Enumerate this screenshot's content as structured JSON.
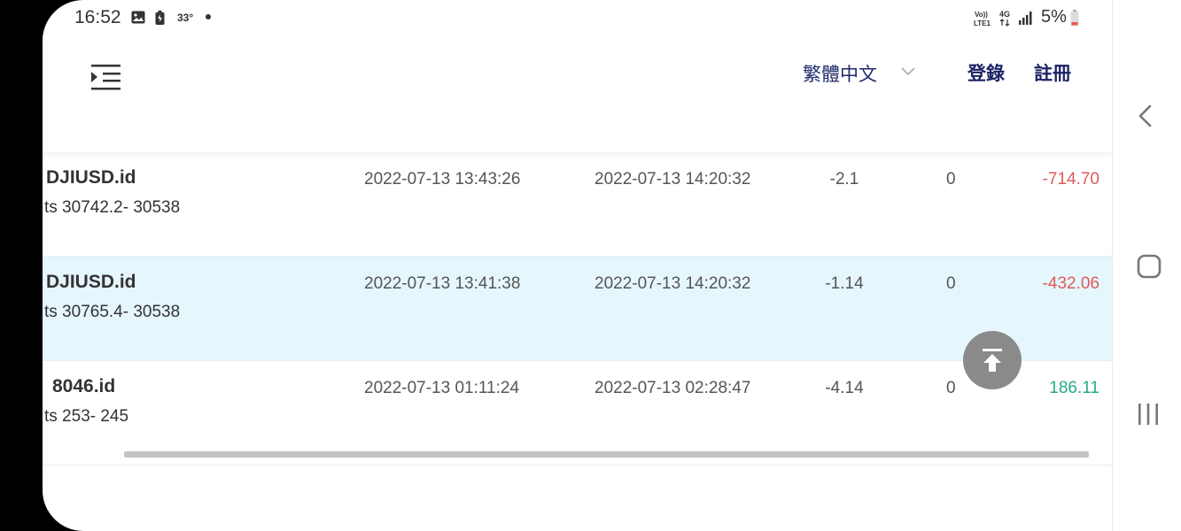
{
  "status_bar": {
    "time": "16:52",
    "temperature": "33°",
    "battery": "5%",
    "icons": [
      "gallery-icon",
      "battery-saver-icon",
      "volte-icon",
      "4g-icon",
      "signal-icon",
      "battery-icon"
    ],
    "volte_label": "Vo)) LTE1",
    "network_label": "4G"
  },
  "header": {
    "language": "繁體中文",
    "login": "登錄",
    "register": "註冊"
  },
  "table": {
    "rows": [
      {
        "symbol": "DJIUSD.id",
        "sub": "ts 30742.2- 30538",
        "open_time": "2022-07-13 13:43:26",
        "close_time": "2022-07-13 14:20:32",
        "lots": "-2.1",
        "swap": "0",
        "profit": "-714.70",
        "profit_sign": "negative"
      },
      {
        "symbol": "DJIUSD.id",
        "sub": "ts 30765.4- 30538",
        "open_time": "2022-07-13 13:41:38",
        "close_time": "2022-07-13 14:20:32",
        "lots": "-1.14",
        "swap": "0",
        "profit": "-432.06",
        "profit_sign": "negative"
      },
      {
        "symbol": "8046.id",
        "sub": "ts 253- 245",
        "open_time": "2022-07-13 01:11:24",
        "close_time": "2022-07-13 02:28:47",
        "lots": "-4.14",
        "swap": "0",
        "profit": "186.11",
        "profit_sign": "positive"
      }
    ]
  },
  "colors": {
    "negative": "#e05a5a",
    "positive": "#27a98a",
    "highlight_row": "#e6f6fd",
    "brand_text": "#1c2363"
  }
}
